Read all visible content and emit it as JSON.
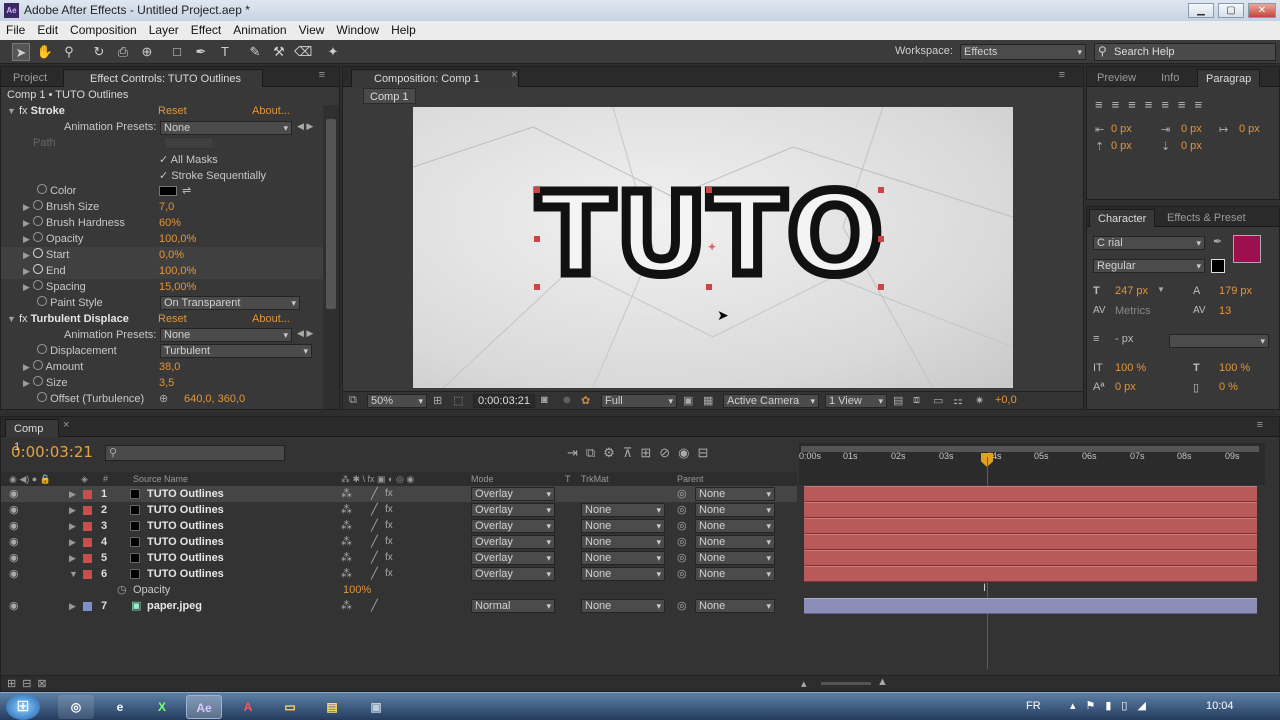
{
  "window": {
    "title": "Adobe After Effects - Untitled Project.aep *",
    "logo": "Ae",
    "min": "▁",
    "max": "▢",
    "close": "✕"
  },
  "menu": [
    "File",
    "Edit",
    "Composition",
    "Layer",
    "Effect",
    "Animation",
    "View",
    "Window",
    "Help"
  ],
  "workspace": {
    "label": "Workspace:",
    "value": "Effects",
    "search_placeholder": "Search Help"
  },
  "left_panel": {
    "tab_project": "Project",
    "tab_effect": "Effect Controls: TUTO Outlines",
    "subtitle": "Comp 1 • TUTO Outlines",
    "stroke": {
      "name": "Stroke",
      "reset": "Reset",
      "about": "About...",
      "anim_presets_label": "Animation Presets:",
      "anim_presets_value": "None",
      "path_label": "Path",
      "all_masks": "All Masks",
      "stroke_seq": "Stroke Sequentially",
      "params": [
        {
          "name": "Color",
          "value": ""
        },
        {
          "name": "Brush Size",
          "value": "7,0"
        },
        {
          "name": "Brush Hardness",
          "value": "60%"
        },
        {
          "name": "Opacity",
          "value": "100,0%"
        },
        {
          "name": "Start",
          "value": "0,0%"
        },
        {
          "name": "End",
          "value": "100,0%"
        },
        {
          "name": "Spacing",
          "value": "15,00%"
        }
      ],
      "paint_style_label": "Paint Style",
      "paint_style_value": "On Transparent"
    },
    "turbulent": {
      "name": "Turbulent Displace",
      "reset": "Reset",
      "about": "About...",
      "anim_presets_label": "Animation Presets:",
      "anim_presets_value": "None",
      "displacement_label": "Displacement",
      "displacement_value": "Turbulent",
      "amount_label": "Amount",
      "amount_value": "38,0",
      "size_label": "Size",
      "size_value": "3,5",
      "offset_label": "Offset (Turbulence)",
      "offset_value": "640,0, 360,0"
    }
  },
  "comp_panel": {
    "tab": "Composition: Comp 1",
    "crumb": "Comp 1",
    "canvas_text": "TUTO",
    "zoom": "50%",
    "timecode": "0:00:03:21",
    "resolution": "Full",
    "camera": "Active Camera",
    "views": "1 View",
    "exposure": "+0,0"
  },
  "right_panel": {
    "tabs": [
      "Preview",
      "Info",
      "Paragrap"
    ],
    "para_values": [
      "0 px",
      "0 px",
      "0 px",
      "0 px",
      "0 px"
    ],
    "char_tabs": [
      "Character",
      "Effects & Preset"
    ],
    "font": "C rial",
    "style": "Regular",
    "size": "247 px",
    "leading": "179 px",
    "kerning": "Metrics",
    "tracking": "13",
    "stroke_width": "- px",
    "vscale": "100 %",
    "hscale": "100 %",
    "baseline": "0 px",
    "tsume": "0 %",
    "fill_color": "#9c1050"
  },
  "timeline": {
    "tab": "Comp 1",
    "timecode": "0:00:03:21",
    "headers": {
      "num": "#",
      "source": "Source Name",
      "mode": "Mode",
      "t": "T",
      "trkmat": "TrkMat",
      "parent": "Parent"
    },
    "ruler": [
      "0:00s",
      "01s",
      "02s",
      "03s",
      "04s",
      "05s",
      "06s",
      "07s",
      "08s",
      "09s"
    ],
    "layers": [
      {
        "num": "1",
        "name": "TUTO Outlines",
        "mode": "Overlay",
        "trkmat": "",
        "parent": "None"
      },
      {
        "num": "2",
        "name": "TUTO Outlines",
        "mode": "Overlay",
        "trkmat": "None",
        "parent": "None"
      },
      {
        "num": "3",
        "name": "TUTO Outlines",
        "mode": "Overlay",
        "trkmat": "None",
        "parent": "None"
      },
      {
        "num": "4",
        "name": "TUTO Outlines",
        "mode": "Overlay",
        "trkmat": "None",
        "parent": "None"
      },
      {
        "num": "5",
        "name": "TUTO Outlines",
        "mode": "Overlay",
        "trkmat": "None",
        "parent": "None"
      },
      {
        "num": "6",
        "name": "TUTO Outlines",
        "mode": "Overlay",
        "trkmat": "None",
        "parent": "None"
      }
    ],
    "opacity_label": "Opacity",
    "opacity_value": "100%",
    "layer7": {
      "num": "7",
      "name": "paper.jpeg",
      "mode": "Normal",
      "trkmat": "None",
      "parent": "None"
    }
  },
  "taskbar": {
    "lang": "FR",
    "clock": "10:04",
    "apps": [
      "chrome",
      "ie",
      "excel",
      "Ae",
      "acrobat",
      "folder",
      "explorer",
      "vs"
    ]
  }
}
